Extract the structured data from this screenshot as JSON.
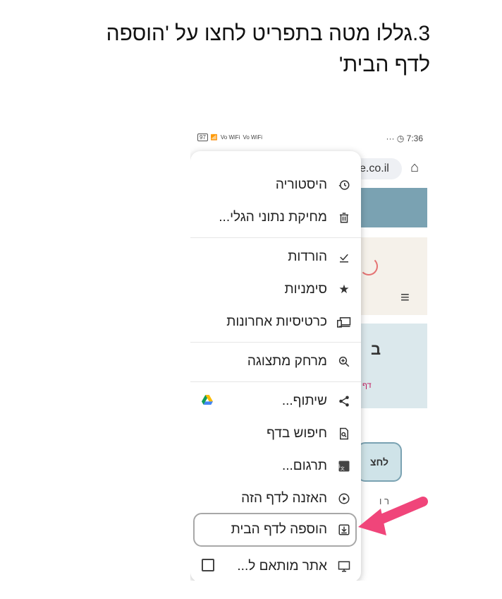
{
  "instruction": {
    "line1": "3.גללו מטה בתפריט לחצו על 'הוספה",
    "line2": "לדף הבית'"
  },
  "status_bar": {
    "battery": "97",
    "network_left": "Vo WiFi",
    "network_right": "Vo WiFi",
    "dots": "···",
    "time": "7:36"
  },
  "browser": {
    "url_fragment": "e.co.il"
  },
  "page_behind": {
    "letter": "ב",
    "small_text": "דף",
    "button_label": "לחצ",
    "partial_text": "ר ו"
  },
  "menu": {
    "items": [
      {
        "label": "היסטוריה",
        "icon": "history-icon"
      },
      {
        "label": "מחיקת נתוני הגלי...",
        "icon": "trash-icon"
      },
      {
        "label": "הורדות",
        "icon": "download-icon"
      },
      {
        "label": "סימניות",
        "icon": "star-icon"
      },
      {
        "label": "כרטיסיות אחרונות",
        "icon": "devices-icon"
      },
      {
        "label": "מרחק מתצוגה",
        "icon": "zoom-icon"
      },
      {
        "label": "שיתוף...",
        "icon": "share-icon"
      },
      {
        "label": "חיפוש בדף",
        "icon": "find-in-page-icon"
      },
      {
        "label": "תרגום...",
        "icon": "translate-icon"
      },
      {
        "label": "האזנה לדף הזה",
        "icon": "play-icon"
      },
      {
        "label": "הוספה לדף הבית",
        "icon": "add-to-home-icon"
      },
      {
        "label": "אתר מותאם ל...",
        "icon": "desktop-icon"
      }
    ]
  },
  "colors": {
    "arrow": "#f0457a",
    "highlight_border": "#a8a8a8",
    "page_header": "#7aa2b2"
  }
}
